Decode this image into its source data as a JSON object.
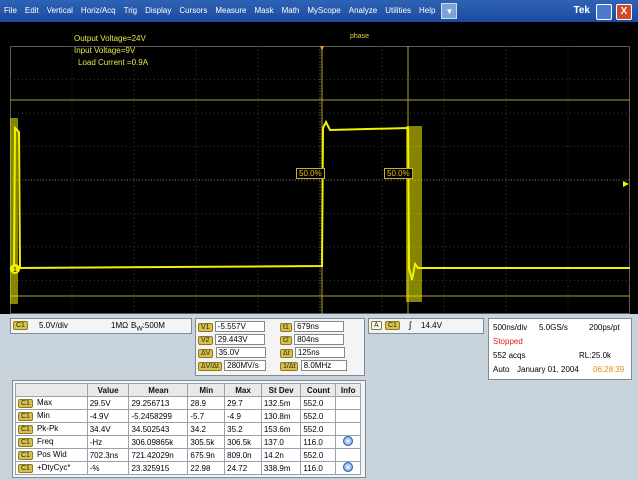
{
  "menu": {
    "items": [
      "File",
      "Edit",
      "Vertical",
      "Horiz/Acq",
      "Trig",
      "Display",
      "Cursors",
      "Measure",
      "Mask",
      "Math",
      "MyScope",
      "Analyze",
      "Utilities",
      "Help"
    ],
    "dropdown_glyph": "▼",
    "brand": "Tek",
    "close_glyph": "X"
  },
  "scope": {
    "annotations": [
      "Output Voltage=24V",
      "Input Voltage=9V",
      "Load Current =0.9A"
    ],
    "phase_label": "phase",
    "pct_left": "50.0%",
    "pct_right": "50.0%",
    "trace_color": "#f2f200",
    "ch1_marker": "1"
  },
  "channel": {
    "badge": "C1",
    "scale": "5.0V/div",
    "impedance": "1MΩ",
    "bw_prefix": "B",
    "bw_sub": "W",
    "bw_value": ":500M"
  },
  "cursors": {
    "v1_label": "V1",
    "v1": "-5.557V",
    "v2_label": "V2",
    "v2": "29.443V",
    "dv_label": "ΔV",
    "dv": "35.0V",
    "dvdt_label": "ΔV/Δt",
    "dvdt": "280MV/s",
    "t1_label": "t1",
    "t1": "679ns",
    "t2_label": "t2",
    "t2": "804ns",
    "dt_label": "Δt",
    "dt": "125ns",
    "inv_label": "1/Δt",
    "inv": "8.0MHz"
  },
  "trigger": {
    "mode_badge": "A",
    "source_badge": "C1",
    "slope_glyph": "∫",
    "level": "14.4V"
  },
  "acquisition": {
    "timebase": "500ns/div",
    "sample_rate": "5.0GS/s",
    "resolution": "200ps/pt",
    "state": "Stopped",
    "acqs": "552 acqs",
    "record_length": "RL:25.0k",
    "mode": "Auto",
    "date": "January 01, 2004",
    "time": "06:28:39"
  },
  "measurements": {
    "columns": [
      "",
      "Value",
      "Mean",
      "Min",
      "Max",
      "St Dev",
      "Count",
      "Info"
    ],
    "rows": [
      {
        "ch": "C1",
        "name": "Max",
        "value": "29.5V",
        "mean": "29.256713",
        "min": "28.9",
        "max": "29.7",
        "stdev": "132.5m",
        "count": "552.0",
        "info": false
      },
      {
        "ch": "C1",
        "name": "Min",
        "value": "-4.9V",
        "mean": "-5.2458299",
        "min": "-5.7",
        "max": "-4.9",
        "stdev": "130.8m",
        "count": "552.0",
        "info": false
      },
      {
        "ch": "C1",
        "name": "Pk-Pk",
        "value": "34.4V",
        "mean": "34.502543",
        "min": "34.2",
        "max": "35.2",
        "stdev": "153.6m",
        "count": "552.0",
        "info": false
      },
      {
        "ch": "C1",
        "name": "Freq",
        "value": "-Hz",
        "mean": "306.09865k",
        "min": "305.5k",
        "max": "306.5k",
        "stdev": "137.0",
        "count": "116.0",
        "info": true
      },
      {
        "ch": "C1",
        "name": "Pos Wid",
        "value": "702.3ns",
        "mean": "721.42029n",
        "min": "675.9n",
        "max": "809.0n",
        "stdev": "14.2n",
        "count": "552.0",
        "info": false
      },
      {
        "ch": "C1",
        "name": "+DtyCyc*",
        "value": "-%",
        "mean": "23.325915",
        "min": "22.98",
        "max": "24.72",
        "stdev": "338.9m",
        "count": "116.0",
        "info": true
      }
    ]
  }
}
